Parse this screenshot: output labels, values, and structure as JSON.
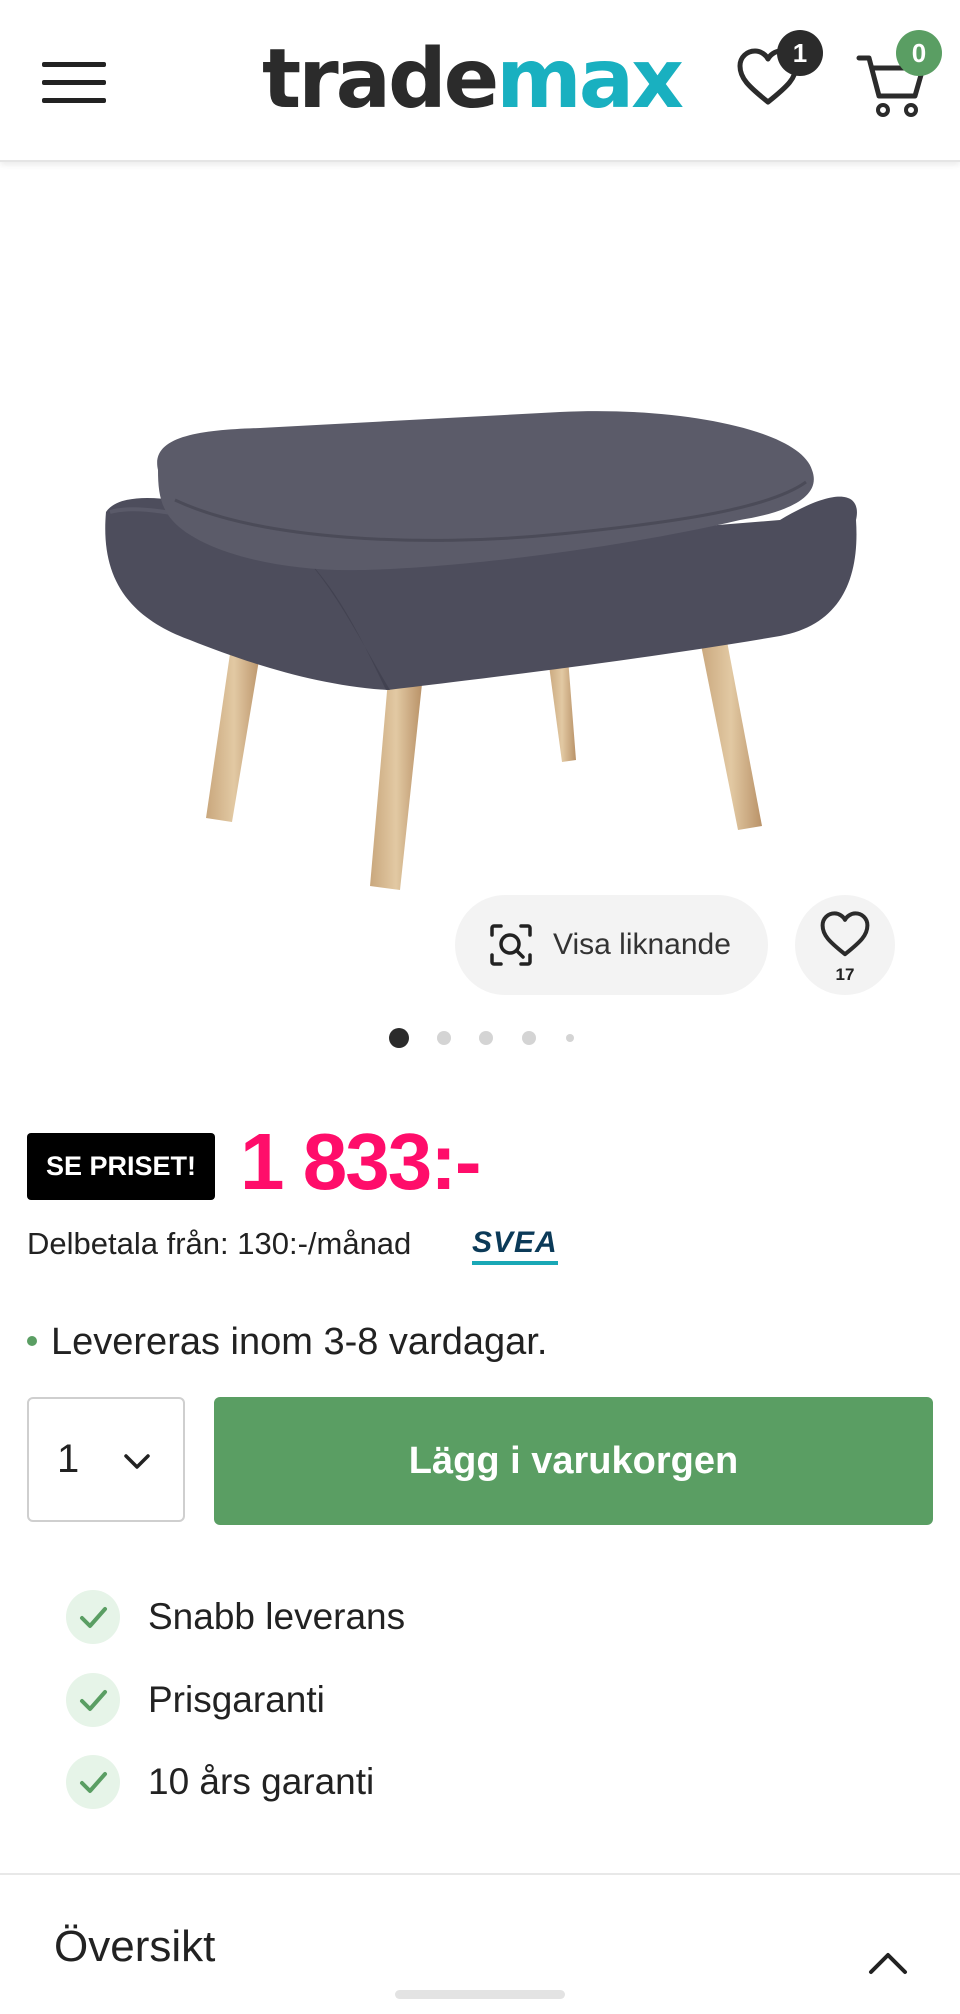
{
  "header": {
    "logo_part1": "trade",
    "logo_part2": "max",
    "wishlist_count": "1",
    "cart_count": "0"
  },
  "gallery": {
    "similar_button_label": "Visa liknande",
    "favorite_count": "17",
    "image_count": 5,
    "active_image": 1
  },
  "pricing": {
    "badge_label": "SE PRISET!",
    "price": "1 833:-",
    "installment_text": "Delbetala från: 130:-/månad",
    "provider_logo": "SVEA"
  },
  "delivery": {
    "text": "Levereras inom 3-8 vardagar."
  },
  "purchase": {
    "quantity": "1",
    "add_to_cart_label": "Lägg i varukorgen"
  },
  "usps": [
    "Snabb leverans",
    "Prisgaranti",
    "10 års garanti"
  ],
  "overview": {
    "title": "Översikt"
  },
  "colors": {
    "accent_green": "#5a9e63",
    "price_pink": "#ff0d6a",
    "logo_teal": "#19b0c0",
    "badge_dark": "#2b2b2b"
  }
}
